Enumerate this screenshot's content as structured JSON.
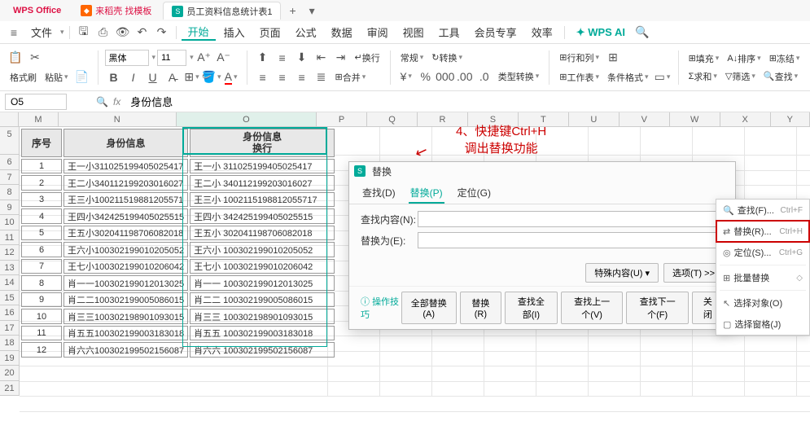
{
  "title_bar": {
    "app": "WPS Office",
    "template_tab": "来稻壳 找模板",
    "doc_tab": "员工资料信息统计表1",
    "add": "+"
  },
  "menu": {
    "file": "文件",
    "start": "开始",
    "insert": "插入",
    "page": "页面",
    "formula": "公式",
    "data": "数据",
    "review": "审阅",
    "view": "视图",
    "tools": "工具",
    "member": "会员专享",
    "efficiency": "效率",
    "ai": "WPS AI"
  },
  "ribbon": {
    "format_painter": "格式刷",
    "paste": "粘贴",
    "font": "黑体",
    "size": "11",
    "wrap": "换行",
    "merge": "合并",
    "general": "常规",
    "convert": "转换",
    "rowcol": "行和列",
    "worksheet": "工作表",
    "cond_format": "条件格式",
    "fill": "填充",
    "sort": "排序",
    "freeze": "冻结",
    "sum": "求和",
    "filter": "筛选",
    "find": "查找"
  },
  "formula_bar": {
    "cell": "O5",
    "value": "身份信息"
  },
  "cols": [
    "M",
    "N",
    "O",
    "P",
    "Q",
    "R",
    "S",
    "T",
    "U",
    "V",
    "W",
    "X",
    "Y"
  ],
  "header": {
    "seq": "序号",
    "id_info": "身份信息",
    "id_info_wrap1": "身份信息",
    "id_info_wrap2": "换行"
  },
  "rows": [
    {
      "seq": "1",
      "n": "王一小311025199405025417",
      "o": "王一小  311025199405025417"
    },
    {
      "seq": "2",
      "n": "王二小340112199203016027",
      "o": "王二小  340112199203016027"
    },
    {
      "seq": "3",
      "n": "王三小100211519881205571",
      "o": "王三小  1002115198812055717"
    },
    {
      "seq": "4",
      "n": "王四小342425199405025515",
      "o": "王四小  342425199405025515"
    },
    {
      "seq": "5",
      "n": "王五小302041198706082018",
      "o": "王五小  302041198706082018"
    },
    {
      "seq": "6",
      "n": "王六小100302199010205052",
      "o": "王六小  100302199010205052"
    },
    {
      "seq": "7",
      "n": "王七小100302199010206042",
      "o": "王七小  100302199010206042"
    },
    {
      "seq": "8",
      "n": "肖一一100302199012013025",
      "o": "肖一一  100302199012013025"
    },
    {
      "seq": "9",
      "n": "肖二二100302199005086015",
      "o": "肖二二  100302199005086015"
    },
    {
      "seq": "10",
      "n": "肖三三100302198901093015",
      "o": "肖三三  100302198901093015"
    },
    {
      "seq": "11",
      "n": "肖五五100302199003183018",
      "o": "肖五五  100302199003183018"
    },
    {
      "seq": "12",
      "n": "肖六六100302199502156087",
      "o": "肖六六  100302199502156087"
    }
  ],
  "dialog": {
    "title": "替换",
    "tab_find": "查找(D)",
    "tab_replace": "替换(P)",
    "tab_goto": "定位(G)",
    "find_label": "查找内容(N):",
    "replace_label": "替换为(E):",
    "special": "特殊内容(U)",
    "options": "选项(T) >>",
    "tips": "操作技巧",
    "replace_all": "全部替换(A)",
    "replace": "替换(R)",
    "find_all": "查找全部(I)",
    "find_prev": "查找上一个(V)",
    "find_next": "查找下一个(F)",
    "close": "关闭"
  },
  "context": {
    "find": "查找(F)...",
    "find_sc": "Ctrl+F",
    "replace": "替换(R)...",
    "replace_sc": "Ctrl+H",
    "goto": "定位(S)...",
    "goto_sc": "Ctrl+G",
    "batch": "批量替换",
    "select_obj": "选择对象(O)",
    "select_pane": "选择窗格(J)"
  },
  "annotation": {
    "line1": "4、快捷键Ctrl+H",
    "line2": "调出替换功能"
  }
}
